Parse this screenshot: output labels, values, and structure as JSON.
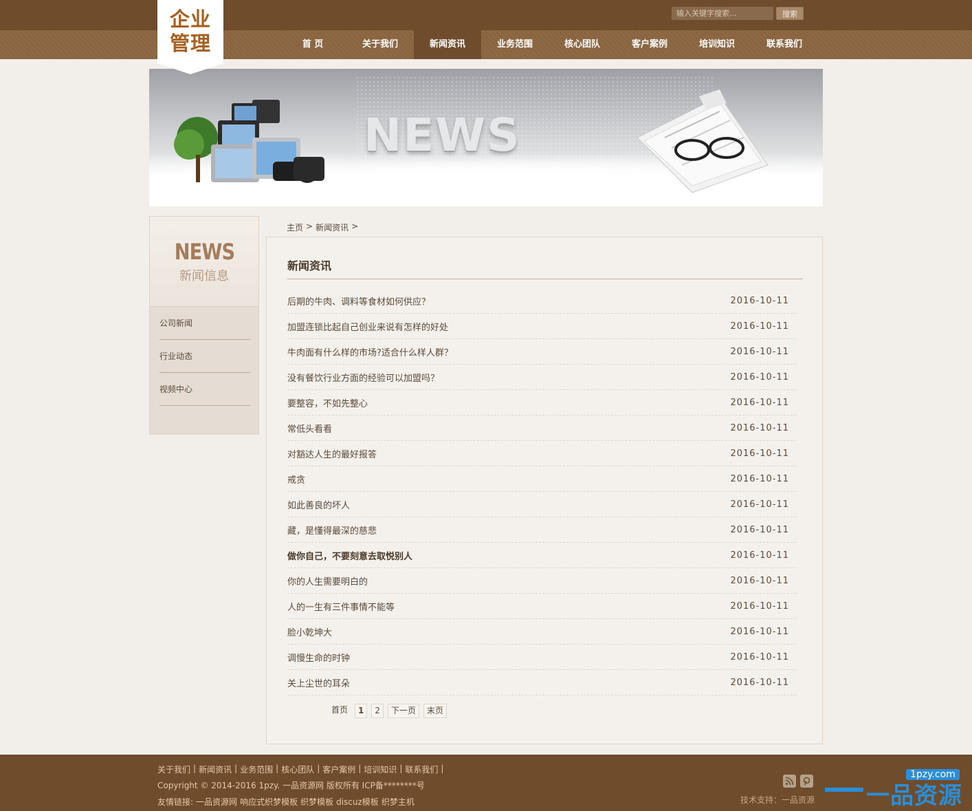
{
  "header": {
    "logo_line1": "企业",
    "logo_line2": "管理",
    "search_placeholder": "输入关键字搜索...",
    "search_button": "搜索"
  },
  "nav": {
    "items": [
      "首 页",
      "关于我们",
      "新闻资讯",
      "业务范围",
      "核心团队",
      "客户案例",
      "培训知识",
      "联系我们"
    ],
    "active": "新闻资讯"
  },
  "banner": {
    "title": "NEWS"
  },
  "breadcrumb": {
    "home": "主页",
    "sep1": ">",
    "current": "新闻资讯",
    "sep2": ">"
  },
  "sidebar": {
    "title_en": "NEWS",
    "title_cn": "新闻信息",
    "items": [
      "公司新闻",
      "行业动态",
      "视频中心"
    ]
  },
  "main": {
    "title": "新闻资讯",
    "articles": [
      {
        "title": "后期的牛肉、调料等食材如何供应？",
        "date": "2016-10-11"
      },
      {
        "title": "加盟连锁比起自己创业来说有怎样的好处",
        "date": "2016-10-11"
      },
      {
        "title": "牛肉面有什么样的市场?适合什么样人群？",
        "date": "2016-10-11"
      },
      {
        "title": "没有餐饮行业方面的经验可以加盟吗？",
        "date": "2016-10-11"
      },
      {
        "title": "要整容，不如先整心",
        "date": "2016-10-11"
      },
      {
        "title": "常低头看看",
        "date": "2016-10-11"
      },
      {
        "title": "对豁达人生的最好报答",
        "date": "2016-10-11"
      },
      {
        "title": "戒贪",
        "date": "2016-10-11"
      },
      {
        "title": "如此善良的坏人",
        "date": "2016-10-11"
      },
      {
        "title": "藏，是懂得最深的慈悲",
        "date": "2016-10-11"
      },
      {
        "title": "做你自己，不要刻意去取悦别人",
        "date": "2016-10-11"
      },
      {
        "title": "你的人生需要明白的",
        "date": "2016-10-11"
      },
      {
        "title": "人的一生有三件事情不能等",
        "date": "2016-10-11"
      },
      {
        "title": "脸小乾坤大",
        "date": "2016-10-11"
      },
      {
        "title": "调慢生命的时钟",
        "date": "2016-10-11"
      },
      {
        "title": "关上尘世的耳朵",
        "date": "2016-10-11"
      }
    ],
    "pager": {
      "first": "首页",
      "page1": "1",
      "page2": "2",
      "next": "下一页",
      "last": "末页"
    }
  },
  "footer": {
    "links": [
      "关于我们",
      "新闻资讯",
      "业务范围",
      "核心团队",
      "客户案例",
      "培训知识",
      "联系我们"
    ],
    "sep": "|",
    "copyright": "Copyright © 2014-2016 1pzy. 一品资源网 版权所有 ICP备********号",
    "friends_label": "友情链接:",
    "friends": [
      "一品资源网",
      "响应式织梦模板",
      "织梦模板",
      "discuz模板",
      "织梦主机"
    ],
    "tech": "技术支持：一品资源",
    "watermark_big": "一品资源网",
    "watermark_small": "1pzy.com"
  },
  "colors": {
    "header_dark": "#6e4c2c",
    "nav_bg": "#8a6440",
    "logo_text": "#a5601e",
    "page_bg": "#f2eee9"
  },
  "icons": [
    "rss-icon",
    "pinterest-icon",
    "search-icon"
  ]
}
